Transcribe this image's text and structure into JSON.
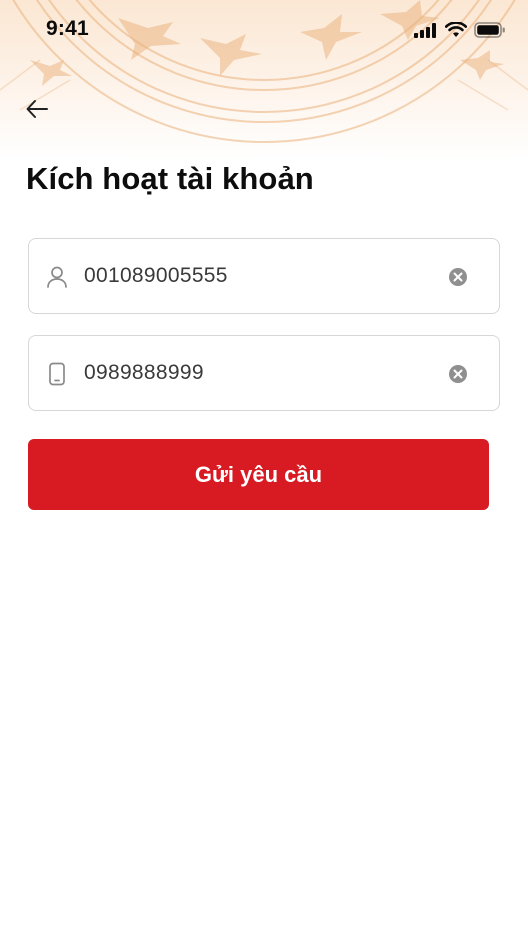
{
  "status_bar": {
    "time": "9:41",
    "icons": [
      "signal-icon",
      "wifi-icon",
      "battery-icon"
    ]
  },
  "header": {
    "back_icon": "arrow-left-icon",
    "title": "Kích hoạt tài khoản",
    "pattern_color": "#e9b07a"
  },
  "form": {
    "id_field": {
      "value": "001089005555",
      "icon": "user-icon",
      "clear_icon": "clear-icon"
    },
    "phone_field": {
      "value": "0989888999",
      "icon": "phone-icon",
      "clear_icon": "clear-icon"
    },
    "submit_label": "Gửi yêu cầu"
  },
  "colors": {
    "primary": "#d81b22",
    "border": "#d7d7d7",
    "input_text": "#3a3a3a"
  }
}
